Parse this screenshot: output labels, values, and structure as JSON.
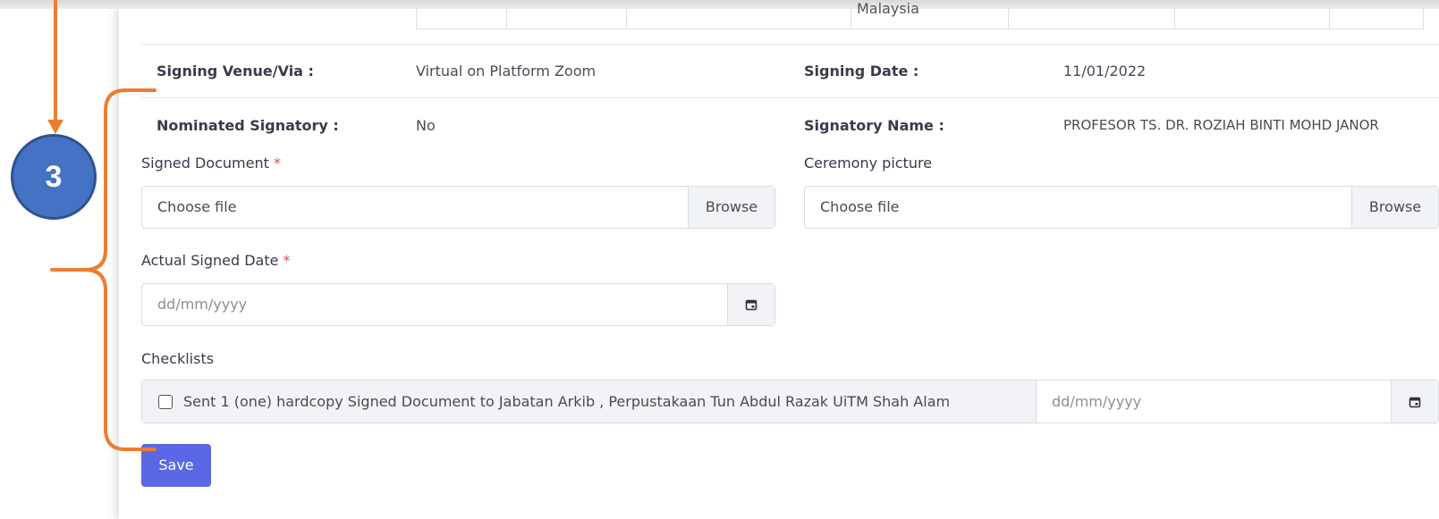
{
  "remnant_text": "Malaysia",
  "info": {
    "signing_venue_label": "Signing Venue/Via :",
    "signing_venue_value": "Virtual on Platform Zoom",
    "signing_date_label": "Signing Date :",
    "signing_date_value": "11/01/2022",
    "nominated_label": "Nominated Signatory :",
    "nominated_value": "No",
    "signatory_name_label": "Signatory Name :",
    "signatory_name_value": "PROFESOR TS. DR. ROZIAH BINTI MOHD JANOR"
  },
  "form": {
    "signed_document_label": "Signed Document",
    "required_mark": "*",
    "signed_document_placeholder": "Choose file",
    "browse_label": "Browse",
    "ceremony_label": "Ceremony picture",
    "ceremony_placeholder": "Choose file",
    "actual_date_label": "Actual Signed Date",
    "date_placeholder": "dd/mm/yyyy",
    "checklists_label": "Checklists",
    "checklist_item": "Sent 1 (one) hardcopy Signed Document to Jabatan Arkib , Perpustakaan Tun Abdul Razak UiTM Shah Alam",
    "checklist_date_placeholder": "dd/mm/yyyy",
    "save_label": "Save"
  },
  "annotation": {
    "step_number": "3",
    "color": "#ed7d31"
  },
  "colors": {
    "primary": "#5b68e5",
    "badge": "#4472c4",
    "required": "#e24c4c"
  },
  "icons": [
    "calendar-icon"
  ]
}
